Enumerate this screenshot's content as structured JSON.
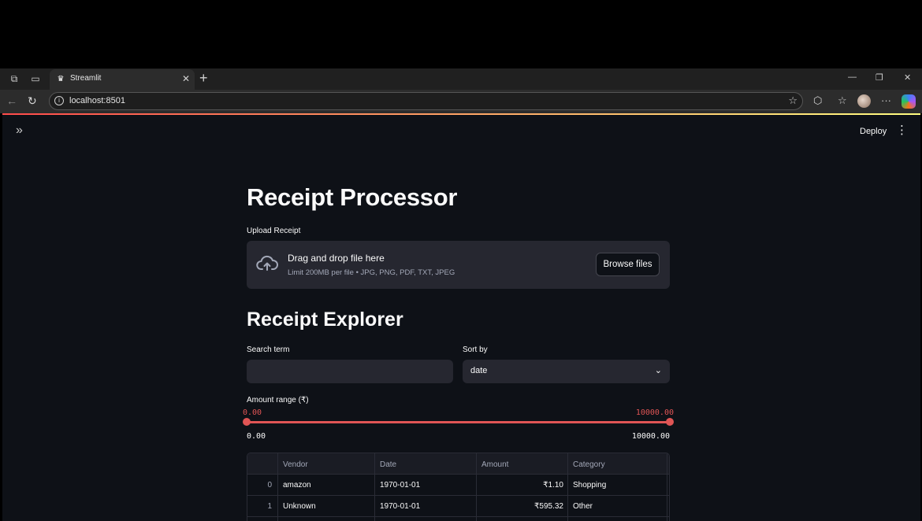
{
  "browser": {
    "tab_title": "Streamlit",
    "url": "localhost:8501"
  },
  "header": {
    "deploy_label": "Deploy"
  },
  "main": {
    "title": "Receipt Processor",
    "upload": {
      "label": "Upload Receipt",
      "drop_title": "Drag and drop file here",
      "limit_text": "Limit 200MB per file • JPG, PNG, PDF, TXT, JPEG",
      "browse_label": "Browse files"
    },
    "explorer_title": "Receipt Explorer",
    "search": {
      "label": "Search term",
      "value": ""
    },
    "sort": {
      "label": "Sort by",
      "value": "date"
    },
    "amount_range": {
      "label": "Amount range (₹)",
      "min_value": "0.00",
      "max_value": "10000.00",
      "min_bound": "0.00",
      "max_bound": "10000.00"
    },
    "table": {
      "columns": [
        "",
        "Vendor",
        "Date",
        "Amount",
        "Category"
      ],
      "rows": [
        {
          "index": "0",
          "vendor": "amazon",
          "date": "1970-01-01",
          "amount": "₹1.10",
          "category": "Shopping"
        },
        {
          "index": "1",
          "vendor": "Unknown",
          "date": "1970-01-01",
          "amount": "₹595.32",
          "category": "Other"
        }
      ]
    }
  },
  "colors": {
    "accent": "#e05555",
    "app_bg": "#0e1117",
    "widget_bg": "#262730"
  }
}
